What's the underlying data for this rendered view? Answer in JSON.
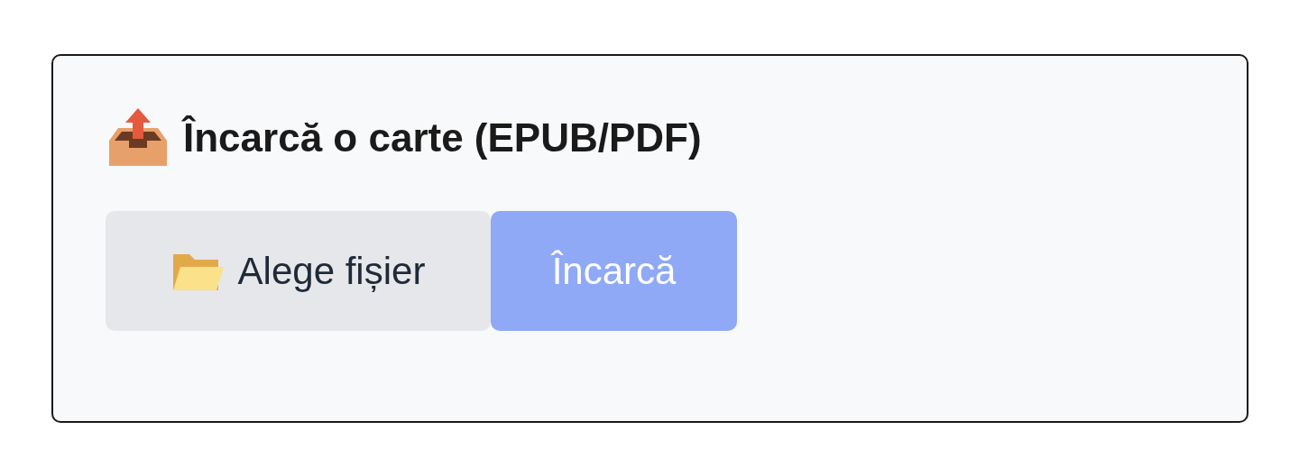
{
  "card": {
    "title": "Încarcă o carte (EPUB/PDF)"
  },
  "buttons": [
    {
      "kind": "file",
      "label": "Alege fișier",
      "disabled": false
    },
    {
      "kind": "submit",
      "label": "Încarcă",
      "disabled": true
    }
  ]
}
